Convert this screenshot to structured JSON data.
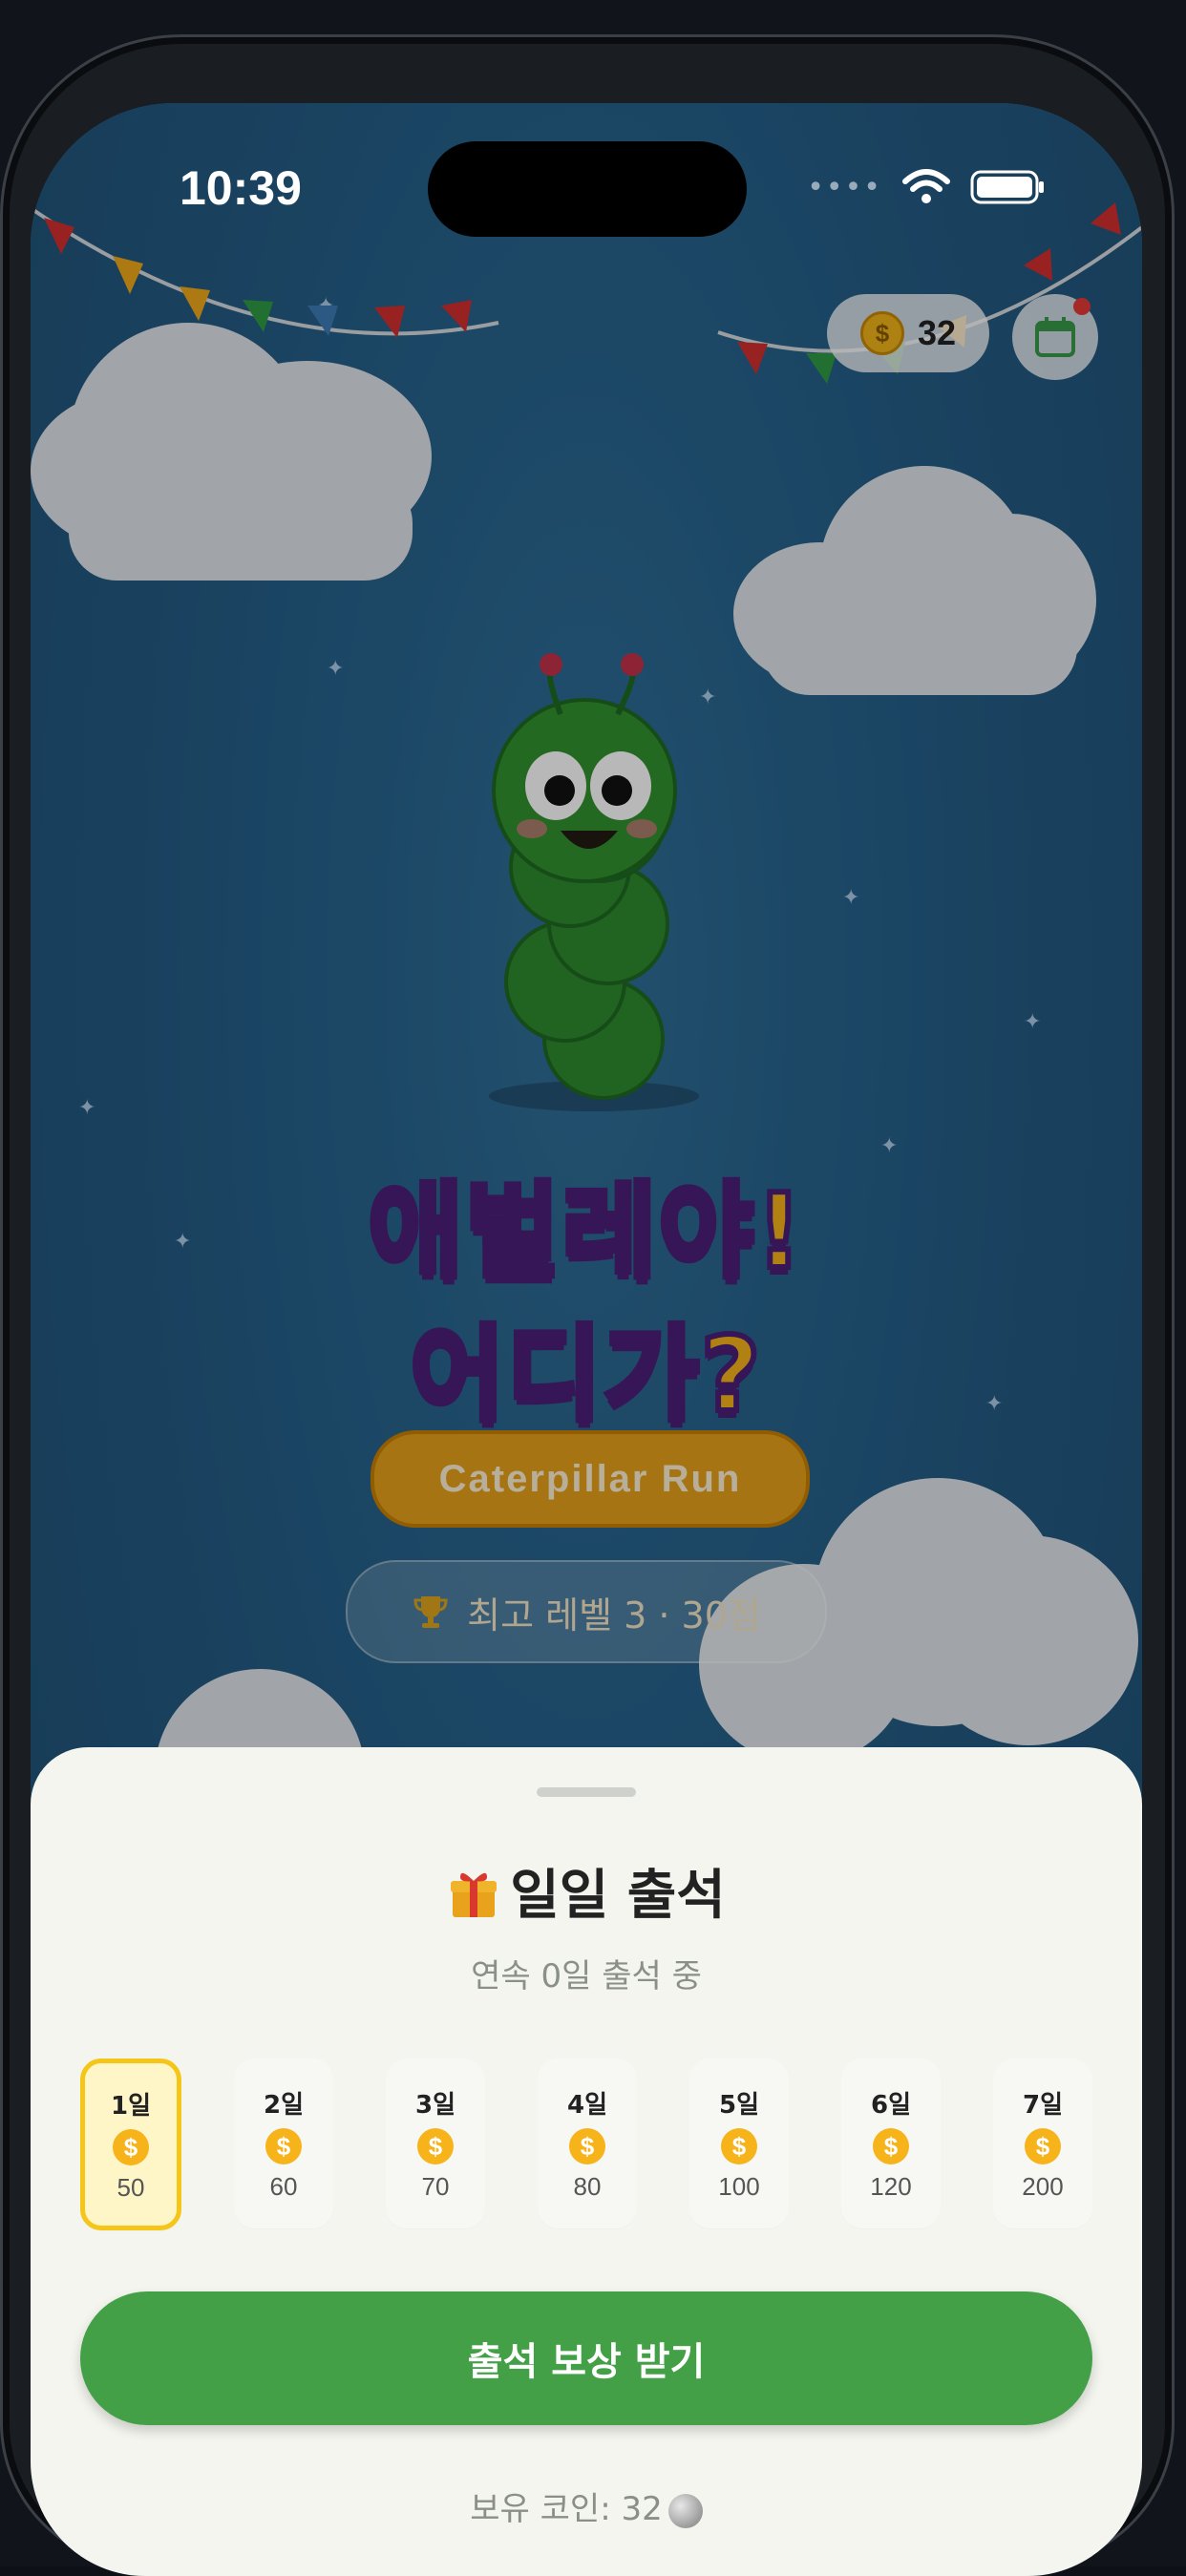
{
  "status_bar": {
    "time": "10:39"
  },
  "header": {
    "coins": "32"
  },
  "game": {
    "title_line1": "애벌레야!",
    "title_line2": "어디가?",
    "subtitle": "Caterpillar Run",
    "best_record": "최고 레벨 3 · 30점"
  },
  "sheet": {
    "title": "일일 출석",
    "streak": "연속 0일 출석 중",
    "days": [
      {
        "label": "1일",
        "amount": "50",
        "active": true
      },
      {
        "label": "2일",
        "amount": "60"
      },
      {
        "label": "3일",
        "amount": "70"
      },
      {
        "label": "4일",
        "amount": "80"
      },
      {
        "label": "5일",
        "amount": "100"
      },
      {
        "label": "6일",
        "amount": "120"
      },
      {
        "label": "7일",
        "amount": "200"
      }
    ],
    "claim_button": "출석 보상 받기",
    "owned_coins": "보유 코인: 32"
  },
  "icons": {
    "coin": "dollar-coin-icon",
    "calendar": "calendar-icon",
    "trophy": "trophy-icon",
    "gift": "gift-icon",
    "moon": "moon-icon"
  },
  "colors": {
    "sky": "#23577c",
    "title_fill": "#f5b51b",
    "title_outline": "#4b1f78",
    "claim_button": "#43a047",
    "active_day_border": "#f5c518"
  }
}
